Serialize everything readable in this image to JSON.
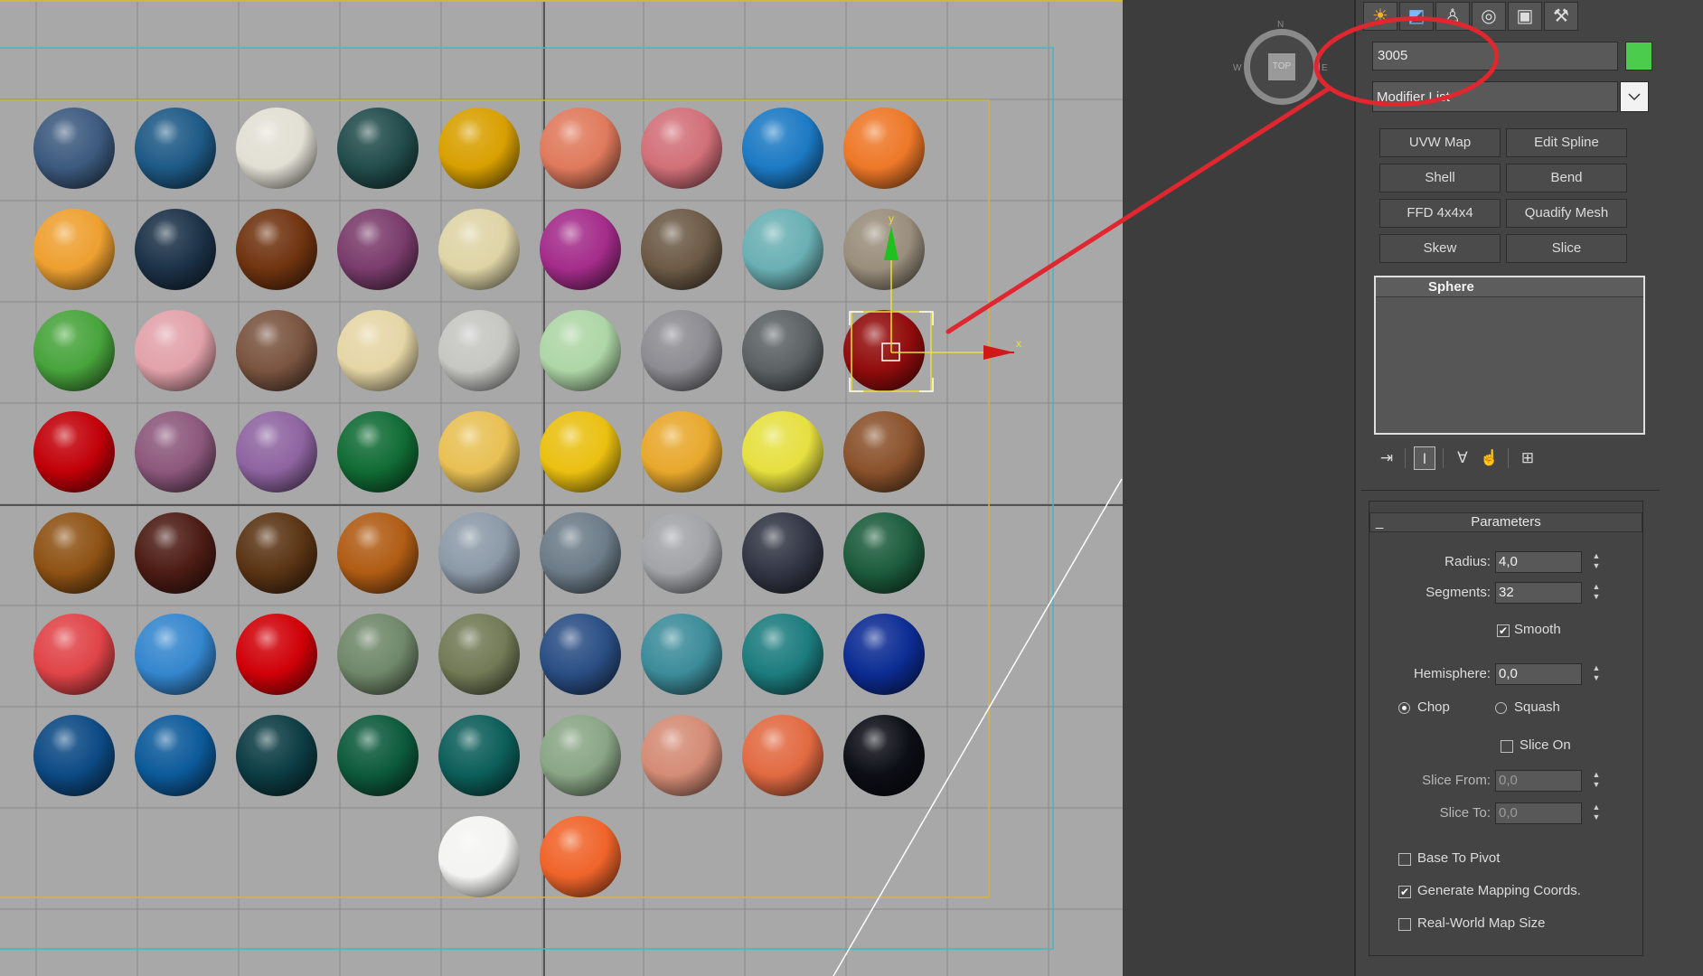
{
  "viewport": {
    "name": "Top viewport",
    "sphere_colors": [
      [
        "#3c5a7e",
        "#1e5a86",
        "#e2e0d4",
        "#224c4c",
        "#d8a000",
        "#e07a5c",
        "#d27078",
        "#1c7ac4",
        "#ee7828"
      ],
      [
        "#eea030",
        "#1c3248",
        "#703410",
        "#7a3c6c",
        "#ded4a6",
        "#a42c8a",
        "#6c5a46",
        "#6ab0b4",
        "#9a8e7c"
      ],
      [
        "#48a43c",
        "#e2a2aa",
        "#7a5440",
        "#e6d6a6",
        "#c6c6c2",
        "#aed6a6",
        "#8c8c92",
        "#5c6264",
        "#920c0c"
      ],
      [
        "#c20008",
        "#8c587c",
        "#8e64a0",
        "#106c34",
        "#e8c054",
        "#eac010",
        "#e8a82c",
        "#e6e040",
        "#8a522c"
      ],
      [
        "#8e5214",
        "#4c1c14",
        "#5a3414",
        "#b05c14",
        "#8c9aa8",
        "#6c7c88",
        "#a2a4a8",
        "#323644",
        "#1c5c3c"
      ],
      [
        "#e04448",
        "#3486ce",
        "#d00008",
        "#70886a",
        "#727a56",
        "#2a4e84",
        "#3c8c9a",
        "#1c7c7e",
        "#0c2c94"
      ],
      [
        "#0c4a84",
        "#0c5a9a",
        "#0c3c44",
        "#0c5a3c",
        "#0c5e5a",
        "#8aa686",
        "#d48c76",
        "#e26a42",
        "#0c0e16"
      ],
      [
        null,
        null,
        null,
        null,
        "#f4f4f2",
        "#f0642a",
        null,
        null,
        null
      ]
    ],
    "selected": {
      "row": 2,
      "col": 8
    },
    "gizmo_labels": {
      "y": "y",
      "x": "x"
    }
  },
  "viewcube": {
    "face": "TOP",
    "n": "N",
    "w": "W",
    "e": "E"
  },
  "command_panel": {
    "tabs": [
      {
        "name": "create-tab",
        "icon": "☀"
      },
      {
        "name": "modify-tab",
        "icon": "◩"
      },
      {
        "name": "hierarchy-tab",
        "icon": "♙"
      },
      {
        "name": "motion-tab",
        "icon": "◎"
      },
      {
        "name": "display-tab",
        "icon": "▣"
      },
      {
        "name": "utilities-tab",
        "icon": "⚒"
      }
    ],
    "object_name": "3005",
    "object_color": "#4ccc4c",
    "modifier_list": "Modifier List",
    "modifier_buttons": [
      "UVW Map",
      "Edit Spline",
      "Shell",
      "Bend",
      "FFD 4x4x4",
      "Quadify Mesh",
      "Skew",
      "Slice"
    ],
    "stack": {
      "item": "Sphere"
    },
    "stack_icons": [
      "⇥",
      "I",
      "∀",
      "☝",
      "⊞"
    ]
  },
  "parameters": {
    "title": "Parameters",
    "collapse": "_",
    "radius_label": "Radius:",
    "radius": "4,0",
    "segments_label": "Segments:",
    "segments": "32",
    "smooth_label": "Smooth",
    "smooth_checked": true,
    "hemisphere_label": "Hemisphere:",
    "hemisphere": "0,0",
    "chop_label": "Chop",
    "squash_label": "Squash",
    "mode": "chop",
    "slice_on_label": "Slice On",
    "slice_on_checked": false,
    "slice_from_label": "Slice From:",
    "slice_from": "0,0",
    "slice_to_label": "Slice To:",
    "slice_to": "0,0",
    "base_to_pivot_label": "Base To Pivot",
    "base_to_pivot_checked": false,
    "gen_mapping_label": "Generate Mapping Coords.",
    "gen_mapping_checked": true,
    "real_world_label": "Real-World Map Size",
    "real_world_checked": false,
    "spinner_up": "▲",
    "spinner_down": "▼",
    "check_mark": "✔"
  },
  "colors": {
    "annotation": "#e0262e",
    "viewport_bg": "#a8a8a8",
    "selection": "#e8e030"
  }
}
